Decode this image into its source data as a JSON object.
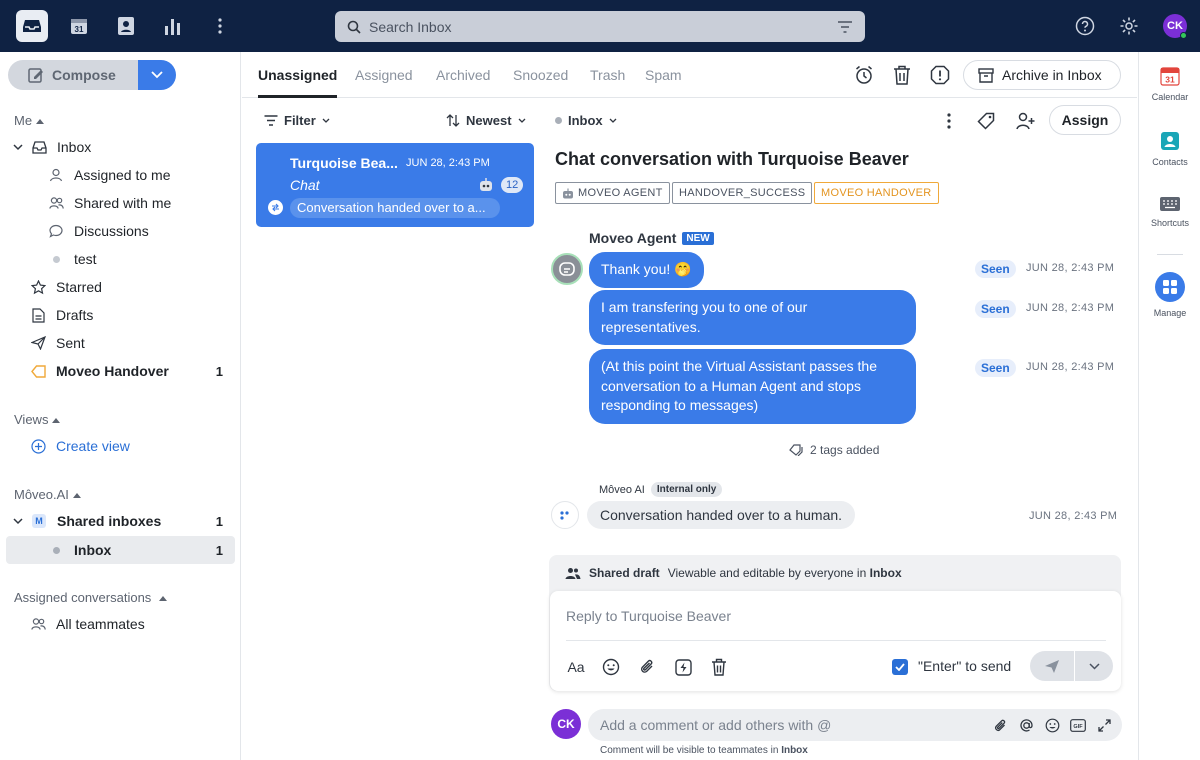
{
  "search": {
    "placeholder": "Search Inbox"
  },
  "user": {
    "initials": "CK"
  },
  "compose": {
    "label": "Compose"
  },
  "sidebar": {
    "me_title": "Me",
    "inbox": "Inbox",
    "assigned_to_me": "Assigned to me",
    "shared_with_me": "Shared with me",
    "discussions": "Discussions",
    "test": "test",
    "starred": "Starred",
    "drafts": "Drafts",
    "sent": "Sent",
    "moveo_handover": "Moveo Handover",
    "moveo_handover_count": "1",
    "views_title": "Views",
    "create_view": "Create view",
    "org_title": "Môveo.AI",
    "org_letter": "M",
    "shared_inboxes": "Shared inboxes",
    "shared_inboxes_count": "1",
    "inbox_sub": "Inbox",
    "inbox_sub_count": "1",
    "assigned_convs_title": "Assigned conversations",
    "all_teammates": "All teammates"
  },
  "tabs": [
    "Unassigned",
    "Assigned",
    "Archived",
    "Snoozed",
    "Trash",
    "Spam"
  ],
  "header": {
    "archive_label": "Archive in Inbox"
  },
  "list": {
    "filter_label": "Filter",
    "sort_label": "Newest",
    "conversation": {
      "title": "Turquoise Bea...",
      "time": "JUN 28, 2:43 PM",
      "channel": "Chat",
      "count": "12",
      "preview": "Conversation handed over to a..."
    }
  },
  "conversation": {
    "inbox_label": "Inbox",
    "assign_label": "Assign",
    "title": "Chat conversation with Turquoise Beaver",
    "tags": [
      "MOVEO AGENT",
      "HANDOVER_SUCCESS",
      "MOVEO HANDOVER"
    ],
    "sender": "Moveo Agent",
    "sender_badge": "NEW",
    "messages": [
      {
        "text": "Thank you! 🤭",
        "status": "Seen",
        "time": "JUN 28, 2:43 PM"
      },
      {
        "text": "I am transfering you to one of our representatives.",
        "status": "Seen",
        "time": "JUN 28, 2:43 PM"
      },
      {
        "text": "(At this point the Virtual Assistant passes the conversation to a Human Agent and stops responding to messages)",
        "status": "Seen",
        "time": "JUN 28, 2:43 PM"
      }
    ],
    "tags_added": "2 tags added",
    "internal": {
      "name": "Môveo AI",
      "badge": "Internal only",
      "text": "Conversation handed over to a human.",
      "time": "JUN 28, 2:43 PM"
    }
  },
  "draft": {
    "label": "Shared draft",
    "desc": "Viewable and editable by everyone in",
    "inbox": "Inbox",
    "placeholder": "Reply to Turquoise Beaver",
    "format_label": "Aa",
    "enter_label": "\"Enter\" to send"
  },
  "comment": {
    "placeholder": "Add a comment or add others with @",
    "gif_label": "GIF",
    "note": "Comment will be visible to teammates in",
    "note_inbox": "Inbox"
  },
  "rail": {
    "calendar_day": "31",
    "calendar": "Calendar",
    "contacts": "Contacts",
    "shortcuts": "Shortcuts",
    "manage": "Manage"
  },
  "colors": {
    "topbar": "#0f2243",
    "accent": "#3a7be8",
    "tag_orange": "#e39420",
    "avatar": "#7b2fd6"
  }
}
